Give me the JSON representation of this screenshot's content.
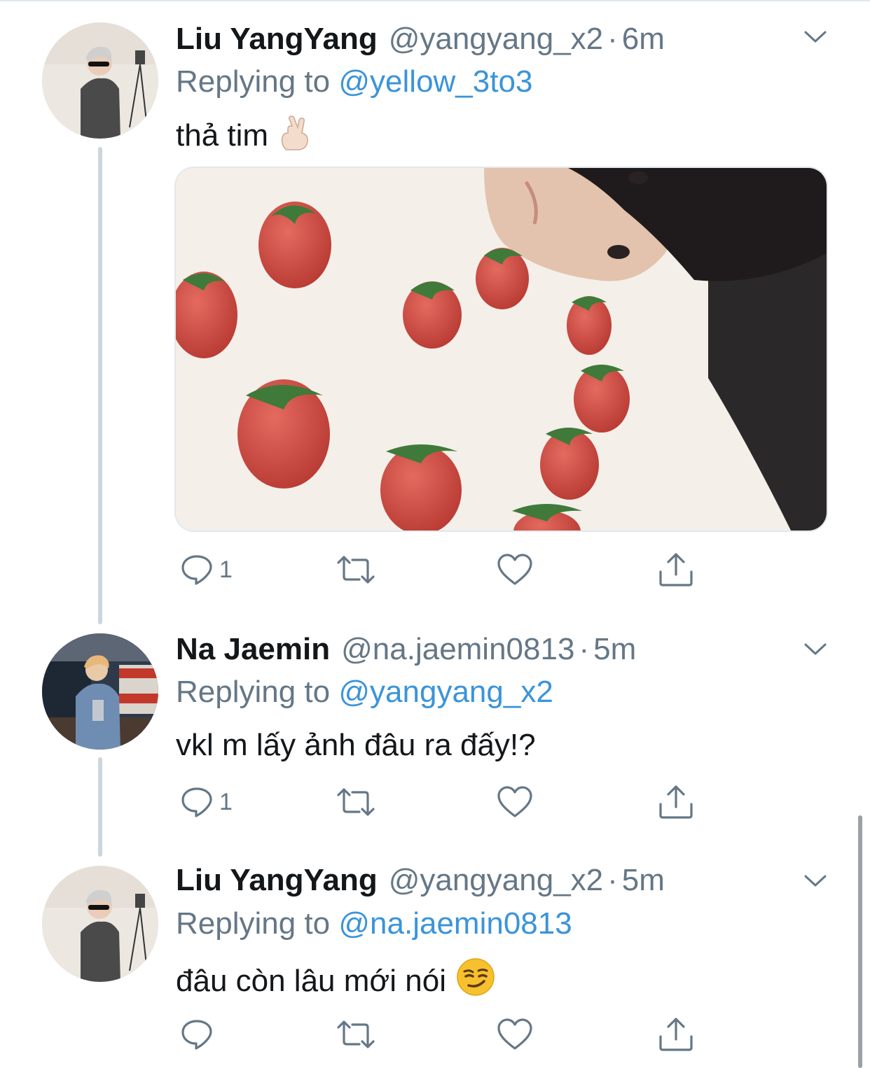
{
  "tweets": [
    {
      "display_name": "Liu YangYang",
      "handle": "@yangyang_x2",
      "separator": "·",
      "time": "6m",
      "replying_prefix": "Replying to",
      "replying_to": "@yellow_3to3",
      "text": "thả tim",
      "emoji": "crossed-fingers-emoji",
      "has_image": true,
      "image_alt": "strawberries arranged on a white table next to a person's face",
      "reply_count": "1",
      "retweet_count": "",
      "like_count": ""
    },
    {
      "display_name": "Na Jaemin",
      "handle": "@na.jaemin0813",
      "separator": "·",
      "time": "5m",
      "replying_prefix": "Replying to",
      "replying_to": "@yangyang_x2",
      "text": "vkl m lấy ảnh đâu ra đấy!?",
      "reply_count": "1",
      "retweet_count": "",
      "like_count": ""
    },
    {
      "display_name": "Liu YangYang",
      "handle": "@yangyang_x2",
      "separator": "·",
      "time": "5m",
      "replying_prefix": "Replying to",
      "replying_to": "@na.jaemin0813",
      "text": "đâu còn lâu mới nói",
      "emoji": "smirking-face-emoji",
      "reply_count": "",
      "retweet_count": "",
      "like_count": ""
    }
  ],
  "colors": {
    "text_primary": "#14171a",
    "text_secondary": "#657786",
    "link": "#3b94d9",
    "thread_line": "#ccd6dd",
    "icon": "#657786"
  },
  "icons": [
    "reply-icon",
    "retweet-icon",
    "like-icon",
    "share-icon",
    "chevron-down-icon"
  ]
}
